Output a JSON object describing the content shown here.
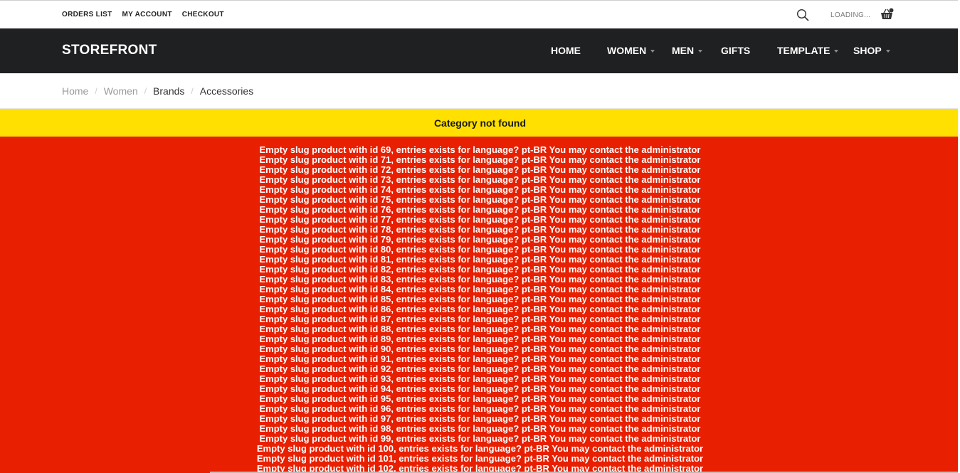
{
  "top_links": [
    "ORDERS LIST",
    "MY ACCOUNT",
    "CHECKOUT"
  ],
  "loading_text": "LOADING...",
  "brand": "STOREFRONT",
  "nav": {
    "home": "HOME",
    "women": "WOMEN",
    "men": "MEN",
    "gifts": "GIFTS",
    "template": "TEMPLATE",
    "shop": "SHOP"
  },
  "breadcrumb": [
    "Home",
    "Women",
    "Brands",
    "Accessories"
  ],
  "alert_warning": "Category not found",
  "errors": [
    "Empty slug product with id 69, entries exists for language? pt-BR You may contact the administrator",
    "Empty slug product with id 71, entries exists for language? pt-BR You may contact the administrator",
    "Empty slug product with id 72, entries exists for language? pt-BR You may contact the administrator",
    "Empty slug product with id 73, entries exists for language? pt-BR You may contact the administrator",
    "Empty slug product with id 74, entries exists for language? pt-BR You may contact the administrator",
    "Empty slug product with id 75, entries exists for language? pt-BR You may contact the administrator",
    "Empty slug product with id 76, entries exists for language? pt-BR You may contact the administrator",
    "Empty slug product with id 77, entries exists for language? pt-BR You may contact the administrator",
    "Empty slug product with id 78, entries exists for language? pt-BR You may contact the administrator",
    "Empty slug product with id 79, entries exists for language? pt-BR You may contact the administrator",
    "Empty slug product with id 80, entries exists for language? pt-BR You may contact the administrator",
    "Empty slug product with id 81, entries exists for language? pt-BR You may contact the administrator",
    "Empty slug product with id 82, entries exists for language? pt-BR You may contact the administrator",
    "Empty slug product with id 83, entries exists for language? pt-BR You may contact the administrator",
    "Empty slug product with id 84, entries exists for language? pt-BR You may contact the administrator",
    "Empty slug product with id 85, entries exists for language? pt-BR You may contact the administrator",
    "Empty slug product with id 86, entries exists for language? pt-BR You may contact the administrator",
    "Empty slug product with id 87, entries exists for language? pt-BR You may contact the administrator",
    "Empty slug product with id 88, entries exists for language? pt-BR You may contact the administrator",
    "Empty slug product with id 89, entries exists for language? pt-BR You may contact the administrator",
    "Empty slug product with id 90, entries exists for language? pt-BR You may contact the administrator",
    "Empty slug product with id 91, entries exists for language? pt-BR You may contact the administrator",
    "Empty slug product with id 92, entries exists for language? pt-BR You may contact the administrator",
    "Empty slug product with id 93, entries exists for language? pt-BR You may contact the administrator",
    "Empty slug product with id 94, entries exists for language? pt-BR You may contact the administrator",
    "Empty slug product with id 95, entries exists for language? pt-BR You may contact the administrator",
    "Empty slug product with id 96, entries exists for language? pt-BR You may contact the administrator",
    "Empty slug product with id 97, entries exists for language? pt-BR You may contact the administrator",
    "Empty slug product with id 98, entries exists for language? pt-BR You may contact the administrator",
    "Empty slug product with id 99, entries exists for language? pt-BR You may contact the administrator",
    "Empty slug product with id 100, entries exists for language? pt-BR You may contact the administrator",
    "Empty slug product with id 101, entries exists for language? pt-BR You may contact the administrator",
    "Empty slug product with id 102, entries exists for language? pt-BR You may contact the administrator"
  ],
  "colors": {
    "navbar_bg": "#1f2022",
    "warning_bg": "#ffe000",
    "error_bg": "#e81f00"
  }
}
